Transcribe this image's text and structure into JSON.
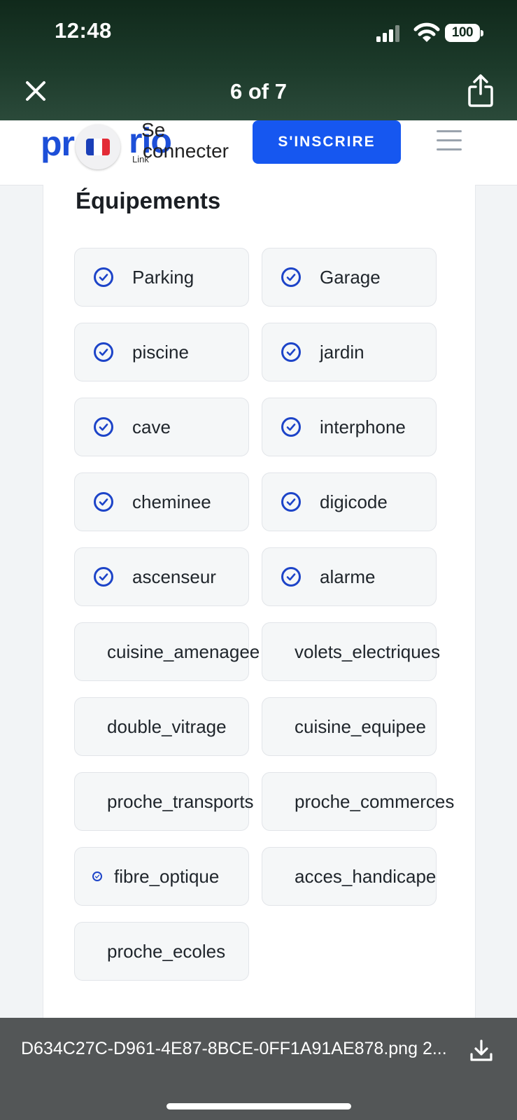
{
  "status_bar": {
    "time": "12:48",
    "battery": "100"
  },
  "viewer": {
    "counter": "6 of 7"
  },
  "site_header": {
    "logo_left": "pr",
    "logo_right": "rio",
    "login_line1": "Se",
    "login_line2": "connecter",
    "login_link_text": "Link",
    "signup_label": "S'INSCRIRE",
    "accent_color": "#1657f0",
    "flag_colors": [
      "#1a3fb8",
      "#ffffff",
      "#e32b36"
    ]
  },
  "section": {
    "title": "Équipements",
    "items": [
      {
        "label": "Parking",
        "checked": true
      },
      {
        "label": "Garage",
        "checked": true
      },
      {
        "label": "piscine",
        "checked": true
      },
      {
        "label": "jardin",
        "checked": true
      },
      {
        "label": "cave",
        "checked": true
      },
      {
        "label": "interphone",
        "checked": true
      },
      {
        "label": "cheminee",
        "checked": true
      },
      {
        "label": "digicode",
        "checked": true
      },
      {
        "label": "ascenseur",
        "checked": true
      },
      {
        "label": "alarme",
        "checked": true
      },
      {
        "label": "cuisine_amenagee",
        "checked": false
      },
      {
        "label": "volets_electriques",
        "checked": false
      },
      {
        "label": "double_vitrage",
        "checked": false
      },
      {
        "label": "cuisine_equipee",
        "checked": false
      },
      {
        "label": "proche_transports",
        "checked": false
      },
      {
        "label": "proche_commerces",
        "checked": false
      },
      {
        "label": "fibre_optique",
        "checked": true,
        "small_icon": true
      },
      {
        "label": "acces_handicape",
        "checked": false
      },
      {
        "label": "proche_ecoles",
        "checked": false
      }
    ]
  },
  "download_bar": {
    "filename": "D634C27C-D961-4E87-8BCE-0FF1A91AE878.png 2..."
  }
}
